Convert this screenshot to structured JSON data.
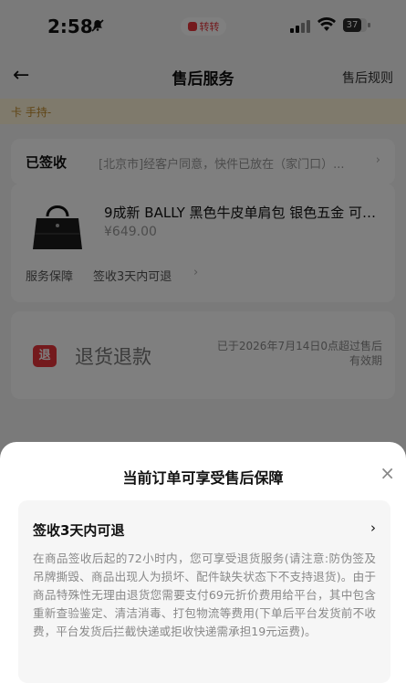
{
  "status": {
    "time": "2:58",
    "pill_text": "转转",
    "battery": "37"
  },
  "nav": {
    "back_icon": "←",
    "title": "售后服务",
    "rules": "售后规则"
  },
  "notice": {
    "text": "卡 手持-"
  },
  "logistics": {
    "status_label": "已签收",
    "detail": "[北京市]经客户同意，快件已放在（家门口）...",
    "chevron": "›"
  },
  "product": {
    "title": "9成新 BALLY 黑色牛皮单肩包 银色五金 可…",
    "price": "¥649.00",
    "guarantee_label": "服务保障",
    "guarantee_value": "签收3天内可退",
    "chevron": "›"
  },
  "refund": {
    "icon_text": "退",
    "label": "退货退款",
    "note_line1": "已于2026年7月14日0点超过售后",
    "note_line2": "有效期"
  },
  "sheet": {
    "title": "当前订单可享受售后保障",
    "close": "×",
    "guarantee_title": "签收3天内可退",
    "guarantee_chevron": "›",
    "guarantee_desc": "在商品签收后起的72小时内，您可享受退货服务(请注意:防伪签及吊牌撕毁、商品出现人为损坏、配件缺失状态下不支持退货)。由于商品特殊性无理由退货您需要支付69元折价费用给平台，其中包含重新查验鉴定、清洁消毒、打包物流等费用(下单后平台发货前不收费，平台发货后拦截快递或拒收快递需承担19元运费)。"
  },
  "colors": {
    "accent": "#e8343b",
    "notice_bg": "#fff4d8",
    "overlay": "rgba(0,0,0,0.5)"
  }
}
